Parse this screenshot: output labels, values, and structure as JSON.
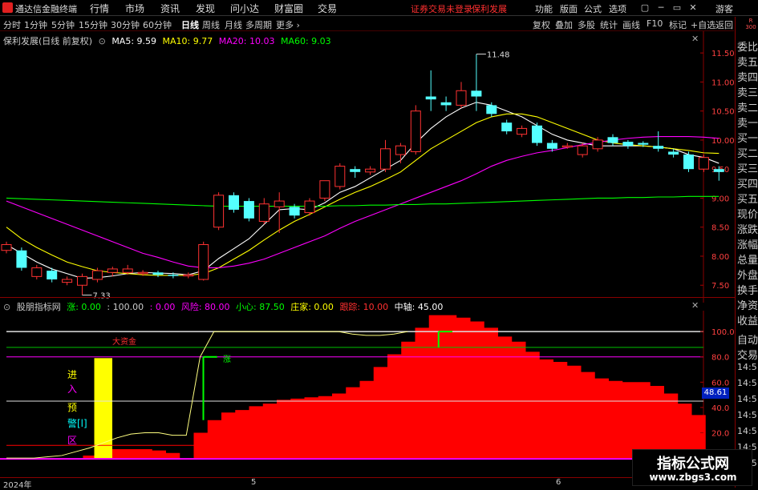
{
  "titlebar": {
    "app_title": "通达信金融终端",
    "menus": [
      "行情",
      "市场",
      "资讯",
      "发现",
      "问小达",
      "财富圈",
      "交易"
    ],
    "trade_status": "证券交易未登录",
    "account_status": "保利发展",
    "right_menus": [
      "功能",
      "版面",
      "公式",
      "选项"
    ],
    "window_buttons": [
      "▢",
      "─",
      "▭",
      "✕"
    ],
    "guest": "游客"
  },
  "periods": [
    "分时",
    "1分钟",
    "5分钟",
    "15分钟",
    "30分钟",
    "60分钟",
    "日线",
    "周线",
    "月线",
    "多周期",
    "更多 ›"
  ],
  "active_period": "日线",
  "toolbar": [
    "复权",
    "叠加",
    "多股",
    "统计",
    "画线",
    "F10",
    "标记",
    "+自选",
    "返回"
  ],
  "right_panel": [
    "委比",
    "卖五",
    "卖四",
    "卖三",
    "卖二",
    "卖一",
    "买一",
    "买二",
    "买三",
    "买四",
    "买五",
    "现价",
    "涨跌",
    "涨幅",
    "总量",
    "外盘",
    "换手",
    "净资",
    "收益",
    "自动",
    "交易"
  ],
  "right_times": [
    "14:5",
    "14:5",
    "14:5",
    "14:5",
    "14:5",
    "14:5",
    "14:5"
  ],
  "r_badge": "R\n300",
  "main_header": {
    "stock": "保利发展(日线 前复权)",
    "ma5": "MA5: 9.59",
    "ma10": "MA10: 9.77",
    "ma20": "MA20: 10.03",
    "ma60": "MA60: 9.03"
  },
  "sub_header": {
    "name": "股朋指标网",
    "zhang": "涨: 0.00",
    "sep1": ": 100.00",
    "sep2": ": 0.00",
    "risk": "风险: 80.00",
    "careful": "小心: 87.50",
    "dealer": "庄家: 0.00",
    "follow": "跟踪: 10.00",
    "axis": "中轴: 45.00"
  },
  "sub_labels": {
    "big_money": "大资金",
    "up": "涨",
    "v1": "进",
    "v2": "入",
    "v3": "预",
    "v4": "警[l]",
    "v5": "区"
  },
  "sub_value_box": "48.61",
  "time_axis": [
    "2024年",
    "5",
    "6"
  ],
  "watermark": {
    "title": "指标公式网",
    "url": "www.zbgs3.com"
  },
  "colors": {
    "up": "#ff3232",
    "down": "#54ffff",
    "ma5": "#ffffff",
    "ma10": "#ffff00",
    "ma20": "#ff00ff",
    "ma60": "#00ff00",
    "accent_red": "#ff0000",
    "yellow": "#ffff00"
  },
  "chart_data": [
    {
      "type": "candlestick",
      "title": "保利发展(日线 前复权)",
      "y_ticks": [
        11.5,
        11.0,
        10.5,
        10.0,
        9.5,
        9.0,
        8.5,
        8.0,
        7.5
      ],
      "ylim": [
        7.2,
        11.75
      ],
      "annotations": [
        {
          "text": "11.48",
          "value": 11.48
        },
        {
          "text": "7.33",
          "value": 7.33
        }
      ],
      "candles": [
        [
          8.1,
          8.2,
          8.05,
          8.25
        ],
        [
          8.1,
          7.8,
          7.75,
          8.15
        ],
        [
          7.65,
          7.8,
          7.6,
          7.85
        ],
        [
          7.75,
          7.6,
          7.55,
          7.8
        ],
        [
          7.55,
          7.6,
          7.5,
          7.65
        ],
        [
          7.5,
          7.65,
          7.33,
          7.7
        ],
        [
          7.6,
          7.75,
          7.55,
          7.8
        ],
        [
          7.72,
          7.78,
          7.65,
          7.82
        ],
        [
          7.72,
          7.78,
          7.68,
          7.85
        ],
        [
          7.7,
          7.72,
          7.66,
          7.76
        ],
        [
          7.72,
          7.68,
          7.64,
          7.75
        ],
        [
          7.68,
          7.66,
          7.62,
          7.72
        ],
        [
          7.66,
          7.68,
          7.62,
          7.72
        ],
        [
          7.6,
          8.2,
          7.58,
          8.25
        ],
        [
          8.5,
          9.05,
          8.45,
          9.1
        ],
        [
          9.05,
          8.8,
          8.75,
          9.1
        ],
        [
          8.95,
          8.65,
          8.6,
          9.0
        ],
        [
          8.6,
          8.9,
          8.55,
          9.0
        ],
        [
          8.85,
          8.95,
          8.4,
          9.1
        ],
        [
          8.85,
          8.7,
          8.65,
          8.9
        ],
        [
          8.75,
          8.95,
          8.7,
          9.0
        ],
        [
          9.0,
          9.3,
          8.95,
          9.3
        ],
        [
          9.2,
          9.55,
          9.15,
          9.6
        ],
        [
          9.5,
          9.45,
          9.35,
          9.55
        ],
        [
          9.45,
          9.5,
          9.4,
          9.55
        ],
        [
          9.5,
          9.85,
          9.45,
          10.0
        ],
        [
          9.75,
          9.9,
          9.6,
          9.95
        ],
        [
          9.8,
          10.5,
          9.75,
          10.6
        ],
        [
          10.75,
          10.7,
          10.5,
          11.2
        ],
        [
          10.65,
          10.6,
          10.5,
          10.75
        ],
        [
          10.6,
          10.85,
          10.55,
          11.0
        ],
        [
          10.85,
          10.75,
          10.5,
          11.48
        ],
        [
          10.6,
          10.45,
          10.4,
          10.65
        ],
        [
          10.3,
          10.15,
          10.1,
          10.35
        ],
        [
          10.1,
          10.2,
          10.05,
          10.25
        ],
        [
          10.25,
          9.95,
          9.9,
          10.3
        ],
        [
          9.95,
          9.85,
          9.8,
          10.0
        ],
        [
          9.9,
          9.9,
          9.85,
          9.95
        ],
        [
          9.75,
          9.9,
          9.7,
          9.95
        ],
        [
          9.85,
          10.0,
          9.8,
          10.05
        ],
        [
          10.05,
          9.95,
          9.9,
          10.1
        ],
        [
          9.97,
          9.9,
          9.85,
          10.0
        ],
        [
          9.95,
          9.92,
          9.88,
          9.98
        ],
        [
          9.9,
          9.85,
          9.8,
          10.15
        ],
        [
          9.8,
          9.75,
          9.7,
          9.85
        ],
        [
          9.75,
          9.5,
          9.45,
          9.8
        ],
        [
          9.5,
          9.7,
          9.45,
          9.75
        ],
        [
          9.5,
          9.45,
          9.3,
          9.55
        ]
      ],
      "series": [
        {
          "name": "MA5",
          "values": [
            8.2,
            8.05,
            7.9,
            7.78,
            7.7,
            7.62,
            7.63,
            7.66,
            7.7,
            7.72,
            7.71,
            7.7,
            7.68,
            7.75,
            7.96,
            8.13,
            8.3,
            8.55,
            8.8,
            8.82,
            8.8,
            8.92,
            9.1,
            9.2,
            9.35,
            9.5,
            9.65,
            9.95,
            10.2,
            10.4,
            10.55,
            10.65,
            10.6,
            10.5,
            10.4,
            10.25,
            10.1,
            10.0,
            9.95,
            9.9,
            9.9,
            9.9,
            9.9,
            9.88,
            9.85,
            9.75,
            9.7,
            9.6
          ]
        },
        {
          "name": "MA10",
          "values": [
            8.5,
            8.3,
            8.15,
            8.02,
            7.9,
            7.82,
            7.75,
            7.72,
            7.7,
            7.68,
            7.67,
            7.67,
            7.67,
            7.7,
            7.8,
            7.95,
            8.1,
            8.28,
            8.45,
            8.6,
            8.72,
            8.85,
            8.98,
            9.1,
            9.2,
            9.32,
            9.45,
            9.65,
            9.85,
            10.0,
            10.15,
            10.3,
            10.4,
            10.45,
            10.45,
            10.4,
            10.3,
            10.2,
            10.1,
            10.0,
            9.95,
            9.92,
            9.9,
            9.88,
            9.85,
            9.82,
            9.78,
            9.77
          ]
        },
        {
          "name": "MA20",
          "values": [
            8.95,
            8.85,
            8.75,
            8.65,
            8.55,
            8.45,
            8.35,
            8.25,
            8.15,
            8.05,
            7.98,
            7.9,
            7.83,
            7.8,
            7.8,
            7.83,
            7.88,
            7.95,
            8.05,
            8.15,
            8.25,
            8.35,
            8.48,
            8.6,
            8.7,
            8.8,
            8.9,
            9.0,
            9.1,
            9.2,
            9.3,
            9.42,
            9.55,
            9.65,
            9.72,
            9.78,
            9.82,
            9.87,
            9.92,
            9.96,
            10.0,
            10.03,
            10.05,
            10.06,
            10.06,
            10.06,
            10.05,
            10.03
          ]
        },
        {
          "name": "MA60",
          "values": [
            9.0,
            8.99,
            8.98,
            8.97,
            8.96,
            8.95,
            8.94,
            8.93,
            8.92,
            8.91,
            8.9,
            8.89,
            8.88,
            8.87,
            8.86,
            8.86,
            8.86,
            8.86,
            8.86,
            8.86,
            8.86,
            8.86,
            8.87,
            8.87,
            8.88,
            8.88,
            8.89,
            8.89,
            8.9,
            8.9,
            8.91,
            8.92,
            8.93,
            8.94,
            8.95,
            8.96,
            8.97,
            8.98,
            8.99,
            9.0,
            9.0,
            9.01,
            9.01,
            9.02,
            9.02,
            9.03,
            9.03,
            9.03
          ]
        }
      ]
    },
    {
      "type": "area",
      "title": "股朋指标网",
      "y_ticks": [
        100.0,
        80.0,
        60.0,
        40.0,
        20.0
      ],
      "ylim": [
        -5,
        114
      ],
      "reference_lines": [
        100,
        87.5,
        80,
        45,
        10
      ],
      "red_values": [
        0,
        0,
        0,
        0,
        0,
        0,
        2,
        5,
        7,
        7,
        7,
        6,
        4,
        0,
        20,
        30,
        36,
        38,
        41,
        43,
        46,
        47,
        48,
        49,
        51,
        56,
        61,
        72,
        82,
        92,
        103,
        113,
        113,
        111,
        108,
        103,
        96,
        92,
        84,
        78,
        76,
        73,
        68,
        63,
        61,
        60,
        60,
        57,
        51,
        43,
        34
      ],
      "yellow_block": {
        "start": 6,
        "end": 8,
        "value": 79
      },
      "green_steps": [
        {
          "from": 14,
          "to": 15,
          "low": 30,
          "high": 80
        },
        {
          "from": 31,
          "to": 32,
          "low": 87.5,
          "high": 100
        }
      ],
      "yellow_line": [
        0,
        0,
        0,
        1,
        2,
        5,
        8,
        12,
        16,
        19,
        20,
        20,
        18,
        18,
        80,
        100,
        100,
        100,
        100,
        100,
        100,
        100,
        100,
        100,
        100,
        98,
        97,
        97,
        98,
        100
      ]
    }
  ]
}
